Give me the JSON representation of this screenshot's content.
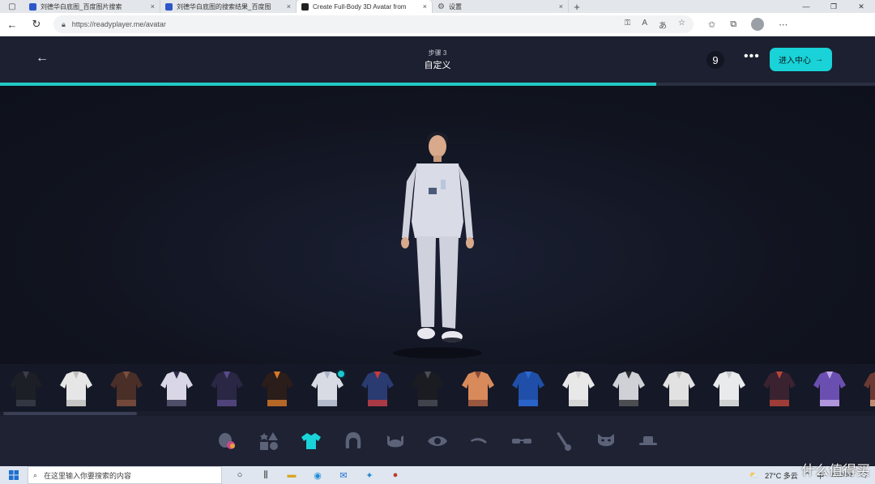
{
  "browser": {
    "tabs": [
      {
        "title": "刘德华白底图_百度图片搜索",
        "active": false
      },
      {
        "title": "刘德华白底图的搜索结果_百度图",
        "active": false
      },
      {
        "title": "Create Full-Body 3D Avatar from",
        "active": true
      },
      {
        "title": "设置",
        "active": false
      }
    ],
    "close_glyph": "×",
    "new_tab_glyph": "+",
    "url": "https://readyplayer.me/avatar"
  },
  "header": {
    "step_label": "步骤 3",
    "step_title": "自定义",
    "count_badge": "9",
    "more_glyph": "•••",
    "enter_button_label": "进入中心"
  },
  "progress": {
    "fraction": 0.75
  },
  "carousel": {
    "selected_index": 6,
    "scroll_fraction": 0.15
  },
  "categories": [
    "face-shape",
    "shapes",
    "outfit",
    "hair",
    "beard",
    "eyes",
    "eyebrows",
    "glasses",
    "makeup",
    "face-mask",
    "hat"
  ],
  "taskbar": {
    "search_placeholder": "在这里输入你要搜索的内容",
    "weather": "27°C 多云",
    "input_method": "中",
    "date": "2022/8/9"
  },
  "watermark": "什么值得买",
  "colors": {
    "accent": "#19d3d8",
    "header_bg": "#1c2030",
    "viewport_bg": "#11141f"
  }
}
